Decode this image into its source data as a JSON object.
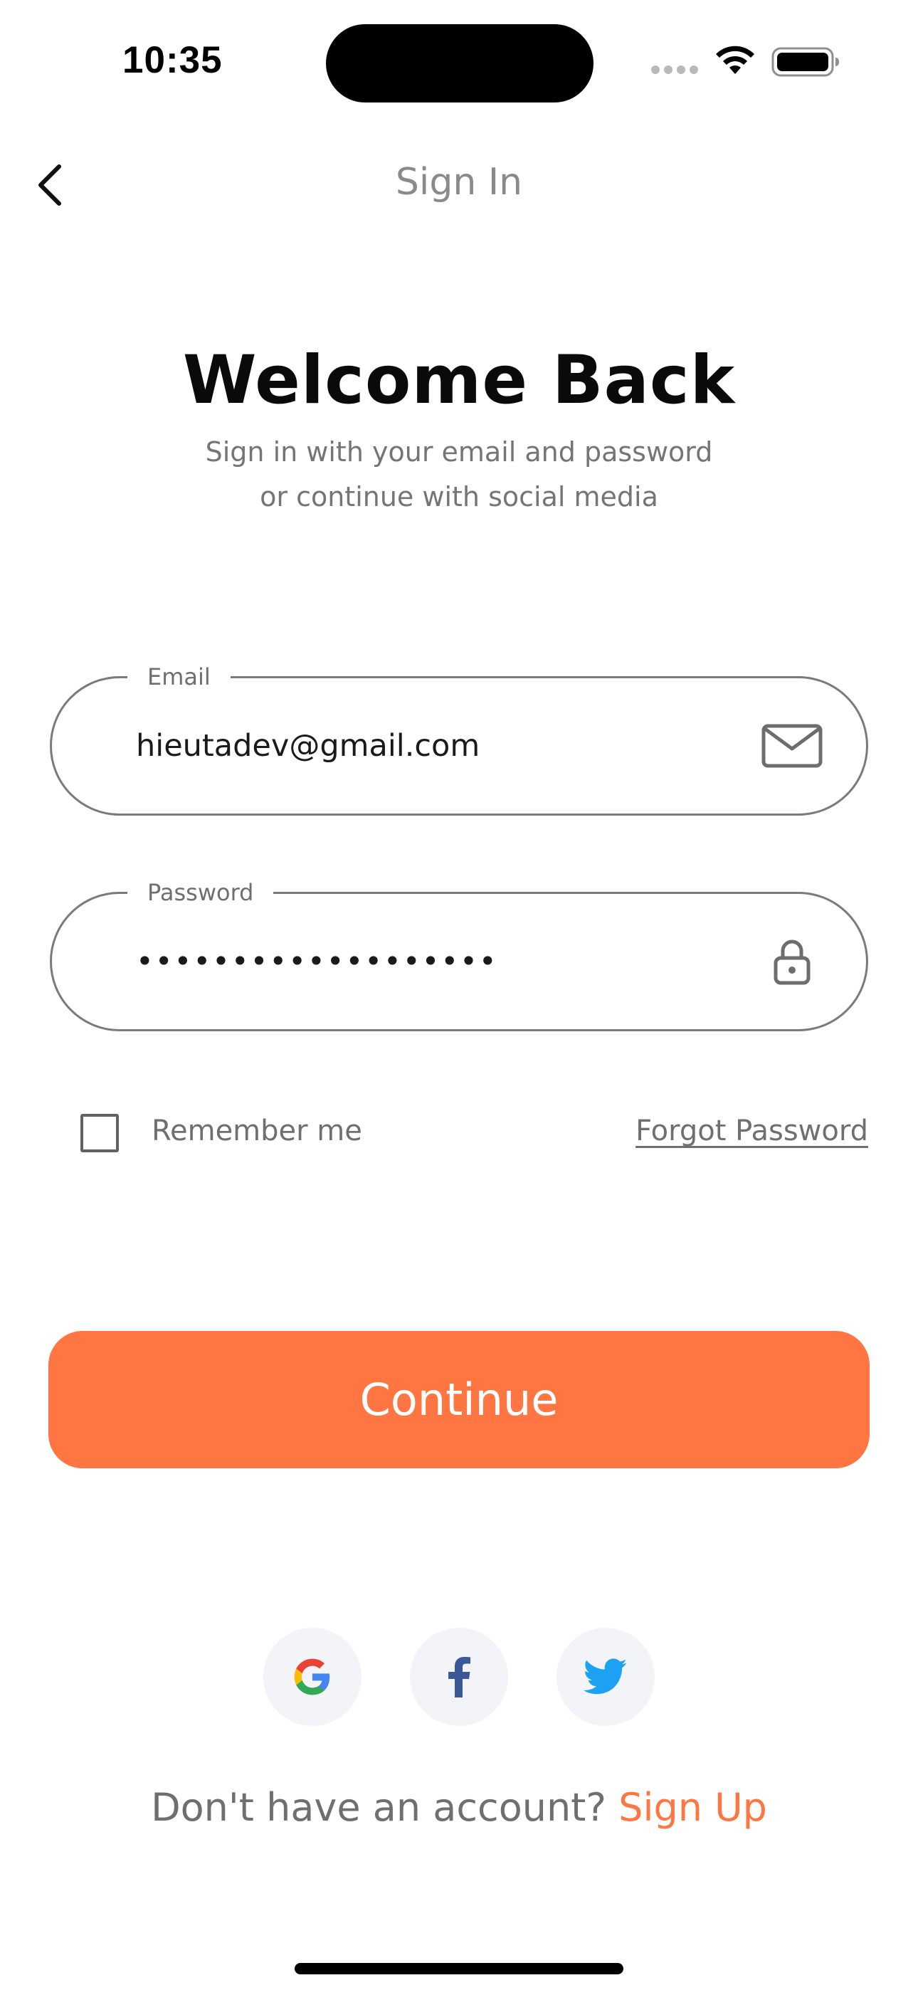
{
  "status_bar": {
    "time": "10:35"
  },
  "nav": {
    "title": "Sign In"
  },
  "heading": {
    "title": "Welcome Back",
    "subtitle_line1": "Sign in with your email and password",
    "subtitle_line2": "or continue with social media"
  },
  "form": {
    "email": {
      "label": "Email",
      "value": "hieutadev@gmail.com",
      "icon": "mail-icon"
    },
    "password": {
      "label": "Password",
      "value": "•••••••••••••••••••",
      "icon": "lock-icon"
    },
    "remember_label": "Remember me",
    "remember_checked": false,
    "forgot_label": "Forgot Password"
  },
  "continue_label": "Continue",
  "social": [
    "google-icon",
    "facebook-icon",
    "twitter-icon"
  ],
  "signup": {
    "prompt": "Don't have an account? ",
    "link": "Sign Up"
  },
  "colors": {
    "accent": "#ff7643",
    "text_muted": "#757575",
    "social_bg": "#f3f4f8",
    "facebook": "#3b5998",
    "twitter": "#1da1f2"
  }
}
